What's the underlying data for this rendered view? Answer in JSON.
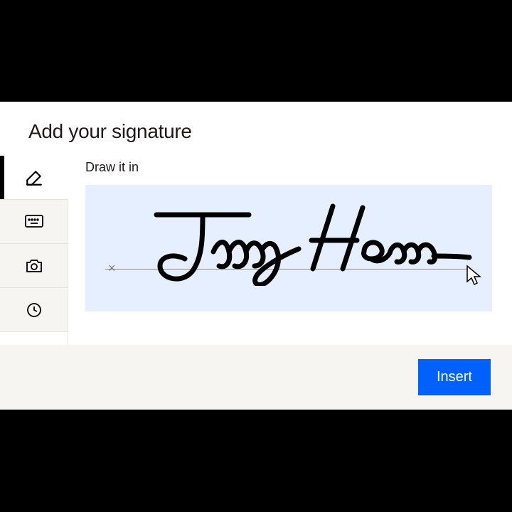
{
  "dialog": {
    "title": "Add your signature",
    "subtitle": "Draw it in",
    "insert_label": "Insert",
    "clear_glyph": "×",
    "colors": {
      "canvas_bg": "#e6efff",
      "accent": "#0061fe",
      "page_bg": "#f7f5f2"
    },
    "tabs": [
      {
        "id": "draw",
        "icon": "pencil-icon",
        "active": true
      },
      {
        "id": "type",
        "icon": "keyboard-icon",
        "active": false
      },
      {
        "id": "upload",
        "icon": "camera-icon",
        "active": false
      },
      {
        "id": "saved",
        "icon": "clock-icon",
        "active": false
      }
    ],
    "signature_present": true
  }
}
